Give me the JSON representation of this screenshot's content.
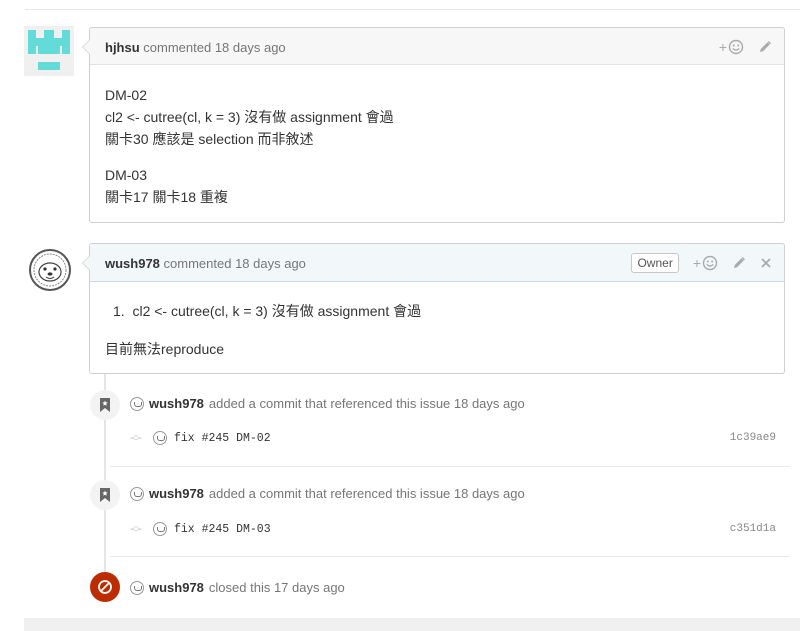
{
  "comments": [
    {
      "author": "hjhsu",
      "action": "commented 18 days ago",
      "paragraphs": [
        [
          "DM-02",
          "cl2 <- cutree(cl, k = 3) 沒有做 assignment 會過",
          "關卡30 應該是 selection 而非敘述"
        ],
        [
          "DM-03",
          "關卡17 關卡18 重複"
        ]
      ],
      "reaction": "+☺",
      "avatar_color": "#63dcd9"
    },
    {
      "author": "wush978",
      "action": "commented 18 days ago",
      "badge": "Owner",
      "list_items": [
        "cl2 <- cutree(cl, k = 3) 沒有做 assignment 會過"
      ],
      "list_number": "1.",
      "text": "目前無法reproduce",
      "reaction": "+☺"
    }
  ],
  "events": [
    {
      "author": "wush978",
      "text": "added a commit that referenced this issue 18 days ago",
      "commit_message": "fix #245 DM-02",
      "sha": "1c39ae9",
      "icon": "bookmark-icon"
    },
    {
      "author": "wush978",
      "text": "added a commit that referenced this issue 18 days ago",
      "commit_message": "fix #245 DM-03",
      "sha": "c351d1a",
      "icon": "bookmark-icon"
    },
    {
      "author": "wush978",
      "text": "closed this 17 days ago",
      "icon": "closed-circle-icon",
      "color": "#bd2c00"
    }
  ]
}
